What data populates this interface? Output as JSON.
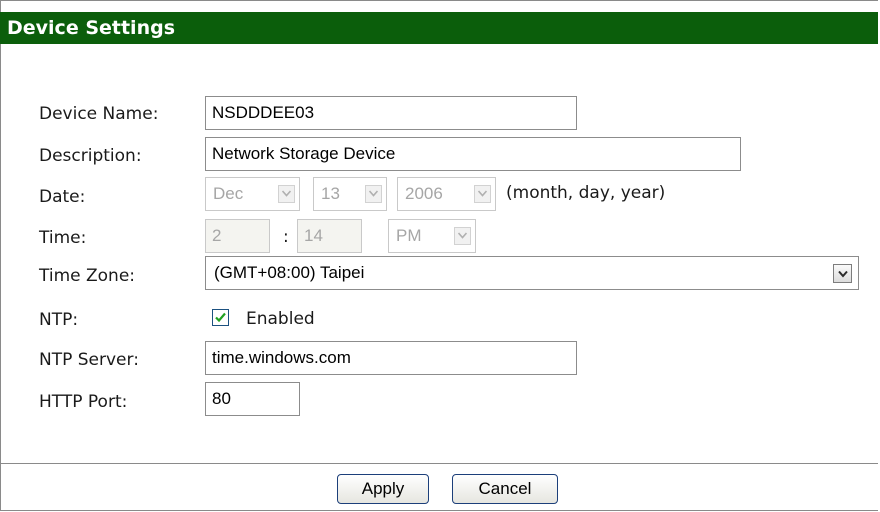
{
  "header": {
    "title": "Device Settings"
  },
  "fields": {
    "device_name": {
      "label": "Device Name:",
      "value": "NSDDDEE03"
    },
    "description": {
      "label": "Description:",
      "value": "Network Storage Device"
    },
    "date": {
      "label": "Date:",
      "month": "Dec",
      "day": "13",
      "year": "2006",
      "hint": "(month, day, year)"
    },
    "time": {
      "label": "Time:",
      "hour": "2",
      "separator": ":",
      "minute": "14",
      "ampm": "PM"
    },
    "time_zone": {
      "label": "Time Zone:",
      "value": "(GMT+08:00) Taipei"
    },
    "ntp": {
      "label": "NTP:",
      "checkbox_label": "Enabled",
      "checked": true
    },
    "ntp_server": {
      "label": "NTP Server:",
      "value": "time.windows.com"
    },
    "http_port": {
      "label": "HTTP Port:",
      "value": "80"
    }
  },
  "buttons": {
    "apply": "Apply",
    "cancel": "Cancel"
  },
  "colors": {
    "header_bg": "#0b5e0b",
    "header_text": "#ffffff",
    "disabled_text": "#a6a6a6"
  }
}
